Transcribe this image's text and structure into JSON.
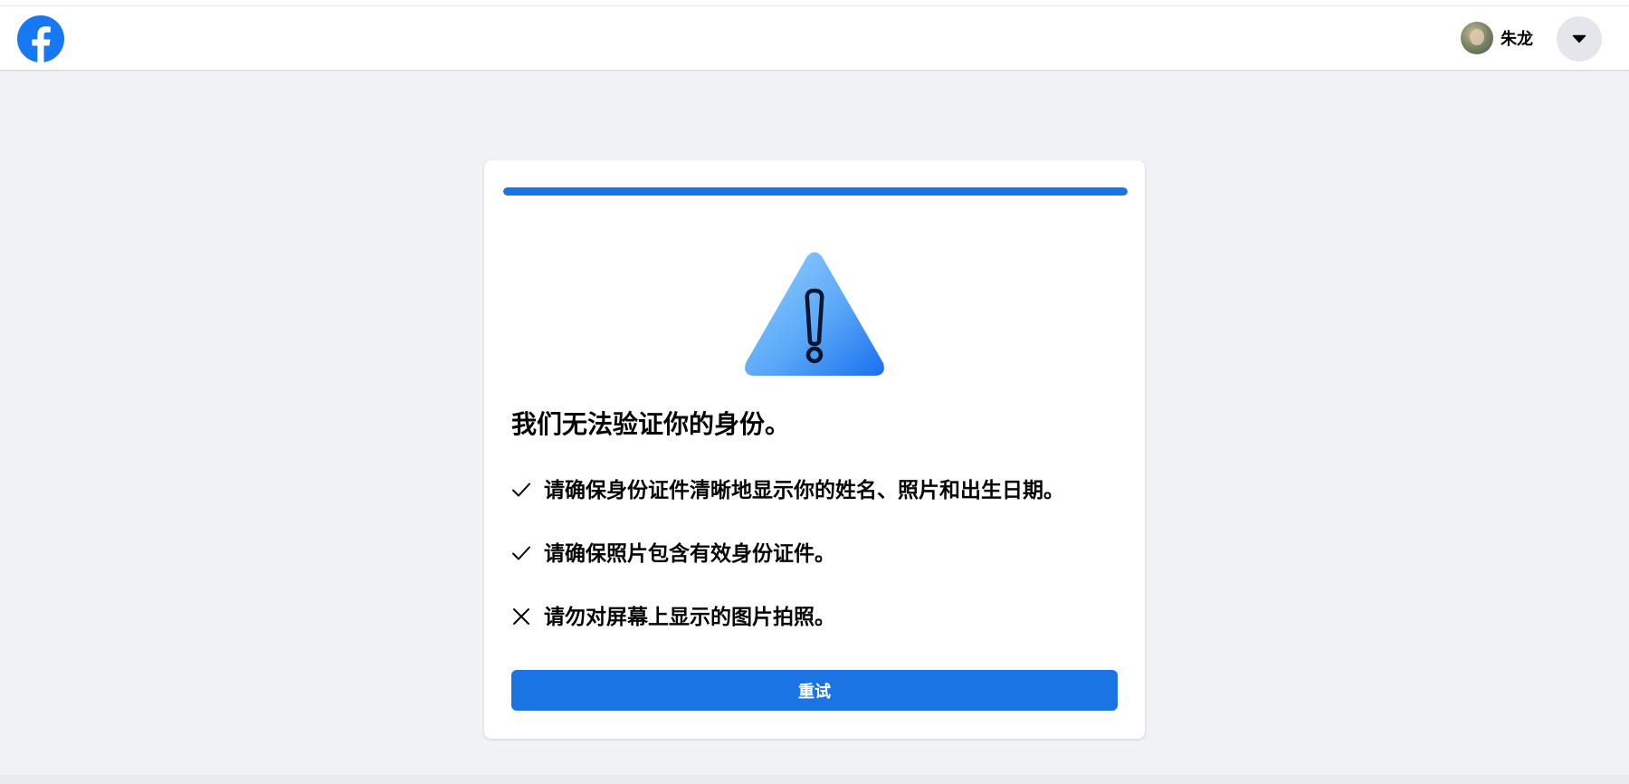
{
  "header": {
    "logo_icon": "facebook-logo-icon",
    "brand_color": "#1877f2",
    "user_name": "朱龙",
    "menu_icon": "caret-down-icon"
  },
  "verification": {
    "progress_fraction": 1.0,
    "progress_color": "#1b74e4",
    "status_icon": "warning-triangle-icon",
    "title": "我们无法验证你的身份。",
    "tips": [
      {
        "icon": "check-icon",
        "text": "请确保身份证件清晰地显示你的姓名、照片和出生日期。"
      },
      {
        "icon": "check-icon",
        "text": "请确保照片包含有效身份证件。"
      },
      {
        "icon": "x-icon",
        "text": "请勿对屏幕上显示的图片拍照。"
      }
    ],
    "retry_label": "重试"
  }
}
